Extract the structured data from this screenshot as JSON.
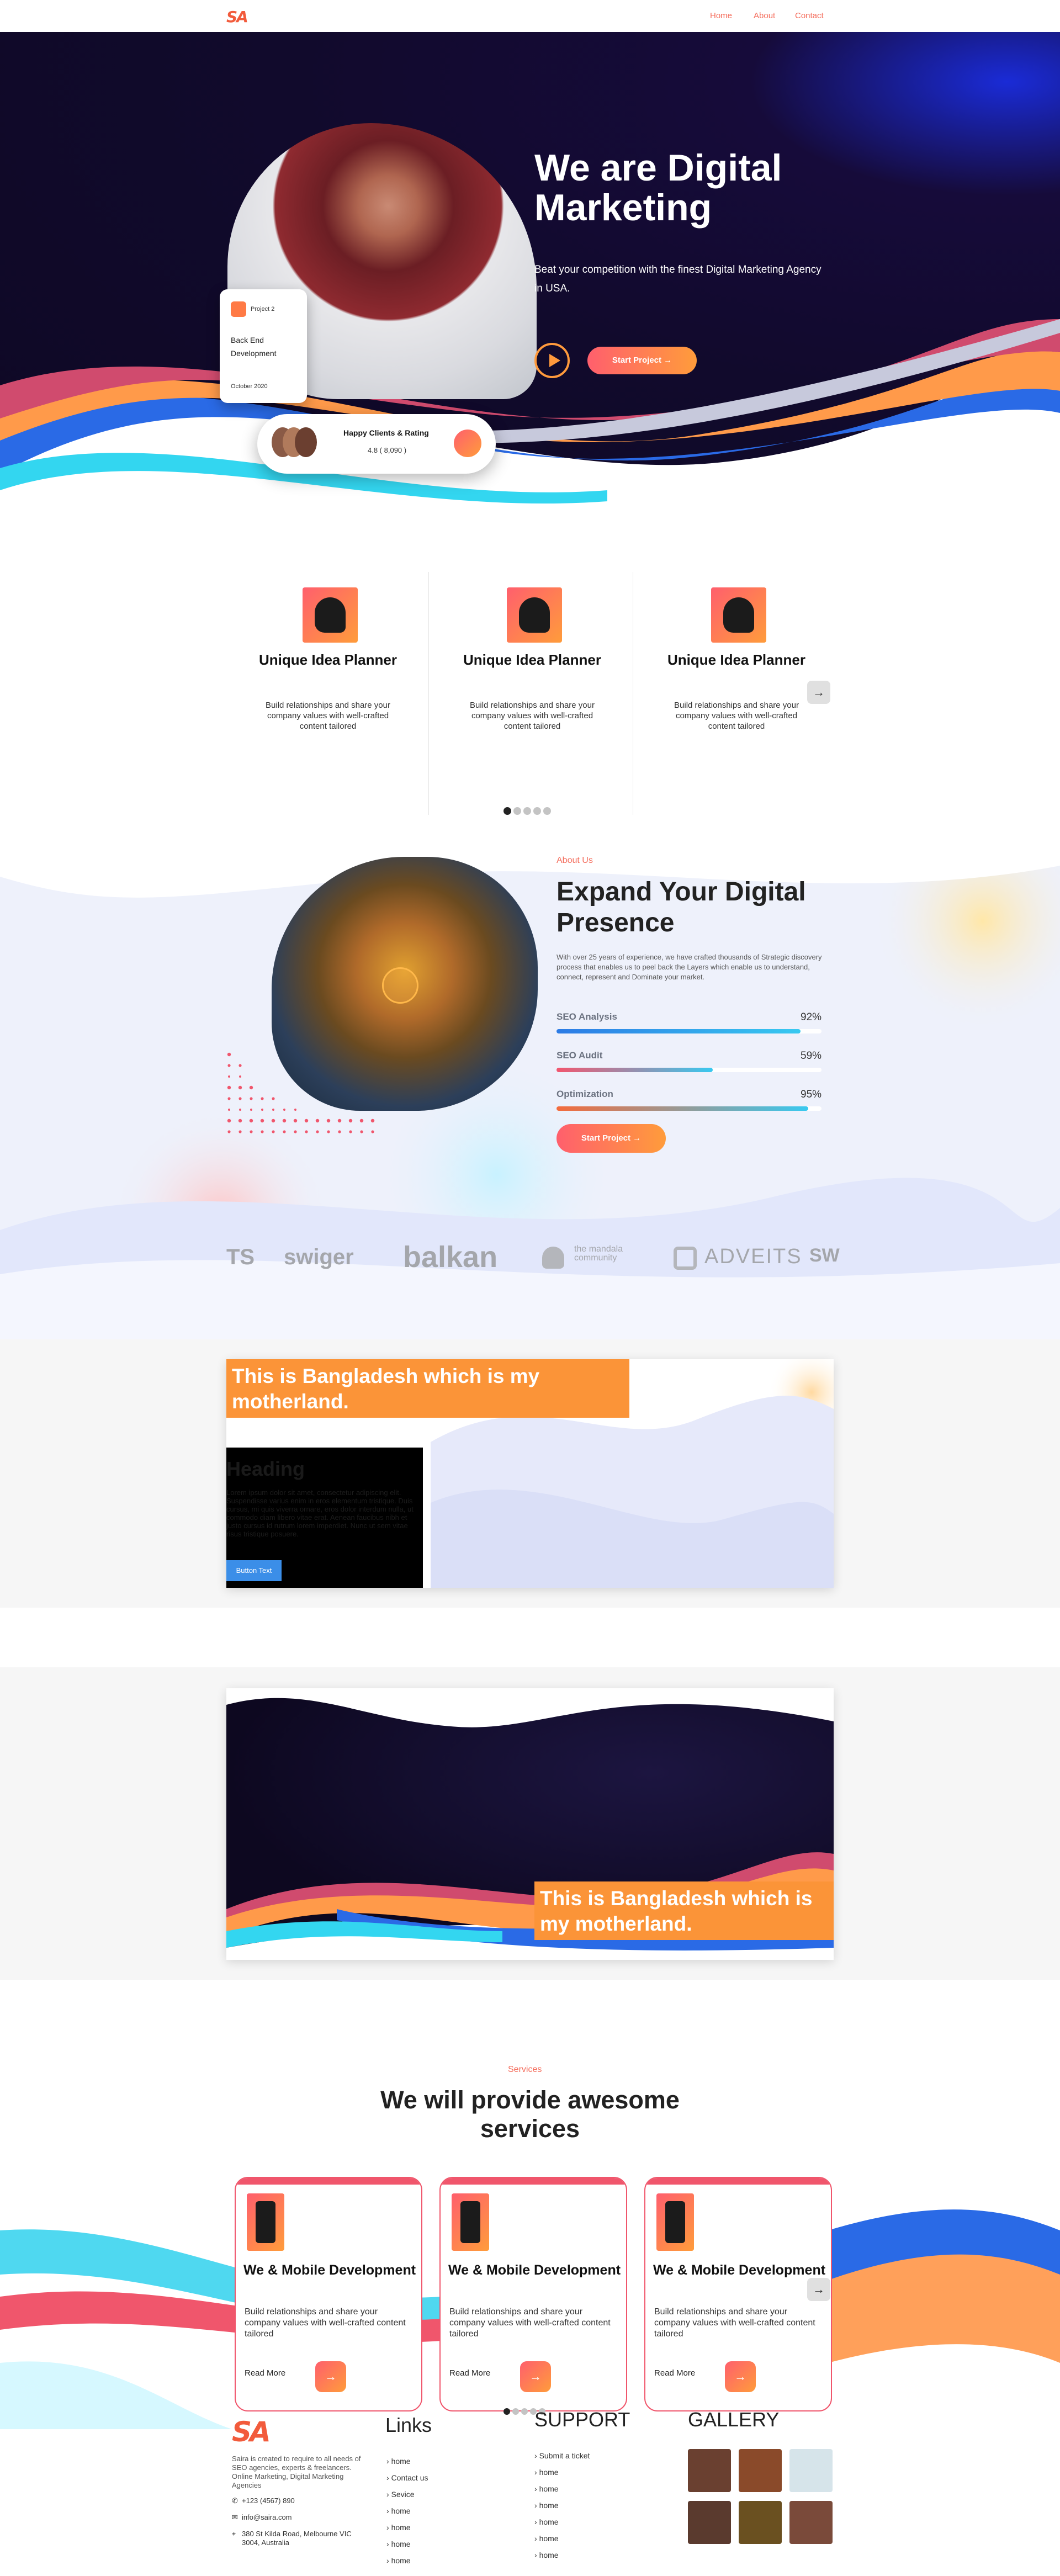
{
  "nav": {
    "logo": "SA",
    "links": [
      "Home",
      "About",
      "Contact"
    ]
  },
  "hero": {
    "title": "We are Digital Marketing",
    "subtitle": "Beat your competition with the finest Digital Marketing Agency in USA.",
    "cta": "Start Project →",
    "project_card": {
      "label": "Project 2",
      "title": "Back End Development",
      "date": "October 2020"
    },
    "rating_card": {
      "title": "Happy Clients & Rating",
      "value": "4.8 ( 8,090 )"
    }
  },
  "features": {
    "items": [
      {
        "title": "Unique Idea Planner",
        "text": "Build relationships and share your company values with well-crafted content tailored"
      },
      {
        "title": "Unique Idea Planner",
        "text": "Build relationships and share your company values with well-crafted content tailored"
      },
      {
        "title": "Unique Idea Planner",
        "text": "Build relationships and share your company values with well-crafted content tailored"
      }
    ],
    "next": "→"
  },
  "about": {
    "eyebrow": "About Us",
    "title": "Expand Your Digital Presence",
    "text": "With over 25 years of experience, we have crafted thousands of Strategic discovery process that enables us to peel back the Layers which enable us to understand, connect, represent and Dominate your market.",
    "skills": [
      {
        "label": "SEO Analysis",
        "percent": "92%",
        "value": 0.92,
        "color": "#2c7be5"
      },
      {
        "label": "SEO Audit",
        "percent": "59%",
        "value": 0.59,
        "color": "#f2566e"
      },
      {
        "label": "Optimization",
        "percent": "95%",
        "value": 0.95,
        "color": "#f46b3c"
      }
    ],
    "cta": "Start Project →"
  },
  "brands": [
    "TS",
    "swiger",
    "balkan",
    "the mandala community",
    "ADVEITS",
    "SW"
  ],
  "banner1": {
    "title": "This is Bangladesh which is my motherland.",
    "heading": "Heading",
    "text": "Lorem ipsum dolor sit amet, consectetur adipiscing elit. Suspendisse varius enim in eros elementum tristique. Duis cursus, mi quis viverra ornare, eros dolor interdum nulla, ut commodo diam libero vitae erat. Aenean faucibus nibh et justo cursus id rutrum lorem imperdiet. Nunc ut sem vitae risus tristique posuere.",
    "button": "Button Text"
  },
  "banner2": {
    "title": "This is Bangladesh which is my motherland."
  },
  "services": {
    "eyebrow": "Services",
    "title": "We will provide awesome services",
    "items": [
      {
        "title": "We & Mobile Development",
        "text": "Build relationships and share your company values with well-crafted content tailored",
        "link": "Read More",
        "arrow": "→"
      },
      {
        "title": "We & Mobile Development",
        "text": "Build relationships and share your company values with well-crafted content tailored",
        "link": "Read More",
        "arrow": "→"
      },
      {
        "title": "We & Mobile Development",
        "text": "Build relationships and share your company values with well-crafted content tailored",
        "link": "Read More",
        "arrow": "→"
      }
    ],
    "next": "→"
  },
  "footer": {
    "logo": "SA",
    "about": "Saira is created to require to all needs of SEO agencies, experts & freelancers. Online Marketing, Digital Marketing Agencies",
    "phone": "+123 (4567) 890",
    "email": "info@saira.com",
    "address": "380 St Kilda Road, Melbourne VIC 3004, Australia",
    "links_title": "Links",
    "links": [
      "home",
      "Contact us",
      "Sevice",
      "home",
      "home",
      "home",
      "home"
    ],
    "support_title": "SUPPORT",
    "support": [
      "Submit a ticket",
      "home",
      "home",
      "home",
      "home",
      "home",
      "home"
    ],
    "gallery_title": "GALLERY"
  }
}
